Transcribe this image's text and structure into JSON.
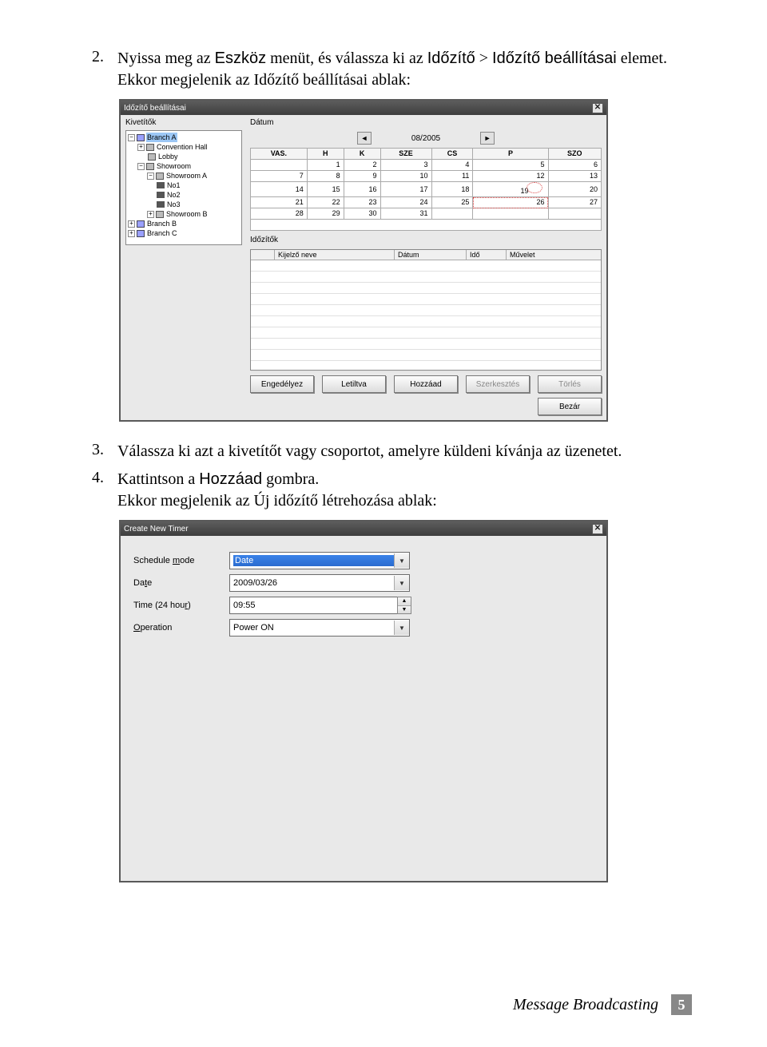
{
  "step2": {
    "num": "2.",
    "text_a": "Nyissa meg az ",
    "text_b": "Eszköz",
    "text_c": " menüt, és válassza ki az ",
    "text_d": "Időzítő",
    "text_e": " > ",
    "text_f": "Időzítő beállításai",
    "text_g": " elemet.",
    "line2": "Ekkor megjelenik az Időzítő beállításai ablak:"
  },
  "win1": {
    "title": "Időzítő beállításai",
    "panel_kivetitok": "Kivetítők",
    "panel_datum": "Dátum",
    "tree": {
      "branchA": "Branch A",
      "conv": "Convention Hall",
      "lobby": "Lobby",
      "showroom": "Showroom",
      "showroomA": "Showroom A",
      "no1": "No1",
      "no2": "No2",
      "no3": "No3",
      "showroomB": "Showroom B",
      "branchB": "Branch B",
      "branchC": "Branch C"
    },
    "month": "08/2005",
    "days": [
      "VAS.",
      "H",
      "K",
      "SZE",
      "CS",
      "P",
      "SZO"
    ],
    "cal": [
      [
        "",
        "1",
        "2",
        "3",
        "4",
        "5",
        "6"
      ],
      [
        "7",
        "8",
        "9",
        "10",
        "11",
        "12",
        "13"
      ],
      [
        "14",
        "15",
        "16",
        "17",
        "18",
        "19",
        "20"
      ],
      [
        "21",
        "22",
        "23",
        "24",
        "25",
        "26",
        "27"
      ],
      [
        "28",
        "29",
        "30",
        "31",
        "",
        "",
        ""
      ]
    ],
    "today_cell": "19",
    "sel_cell": "26",
    "panel_idozitok": "Időzítők",
    "sched_cols": {
      "name": "Kijelző neve",
      "date": "Dátum",
      "time": "Idő",
      "op": "Művelet"
    },
    "buttons": {
      "enable": "Engedélyez",
      "disable": "Letiltva",
      "add": "Hozzáad",
      "edit": "Szerkesztés",
      "del": "Törlés",
      "close": "Bezár"
    }
  },
  "step3": {
    "num": "3.",
    "text": "Válassza ki azt a kivetítőt vagy csoportot, amelyre küldeni kívánja az üzenetet."
  },
  "step4": {
    "num": "4.",
    "text_a": "Kattintson a ",
    "text_b": "Hozzáad",
    "text_c": " gombra.",
    "line2": "Ekkor megjelenik az Új időzítő létrehozása ablak:"
  },
  "win2": {
    "title": "Create New Timer",
    "labels": {
      "mode_pre": "Schedule ",
      "mode_u": "m",
      "mode_post": "ode",
      "date_pre": "Da",
      "date_u": "t",
      "date_post": "e",
      "time_pre": "Time ",
      "time_paren": "(24 hou",
      "time_u": "r",
      "time_post": ")",
      "op_u": "O",
      "op_post": "peration"
    },
    "values": {
      "mode": "Date",
      "date": "2009/03/26",
      "time": "09:55",
      "operation": "Power ON"
    }
  },
  "footer": {
    "doc": "Message Broadcasting",
    "page": "5"
  }
}
